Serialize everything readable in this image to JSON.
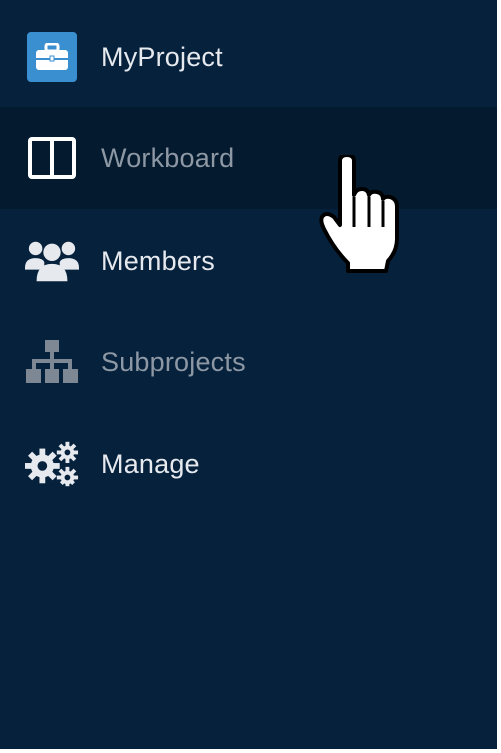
{
  "sidebar": {
    "items": [
      {
        "label": "MyProject",
        "icon": "briefcase-icon"
      },
      {
        "label": "Workboard",
        "icon": "columns-icon"
      },
      {
        "label": "Members",
        "icon": "users-icon"
      },
      {
        "label": "Subprojects",
        "icon": "sitemap-icon"
      },
      {
        "label": "Manage",
        "icon": "gears-icon"
      }
    ]
  },
  "colors": {
    "background": "#06213c",
    "hover_background": "#041a2e",
    "accent": "#3a8fd1",
    "text": "#e6e9ee",
    "muted_text": "#8d98a4"
  }
}
